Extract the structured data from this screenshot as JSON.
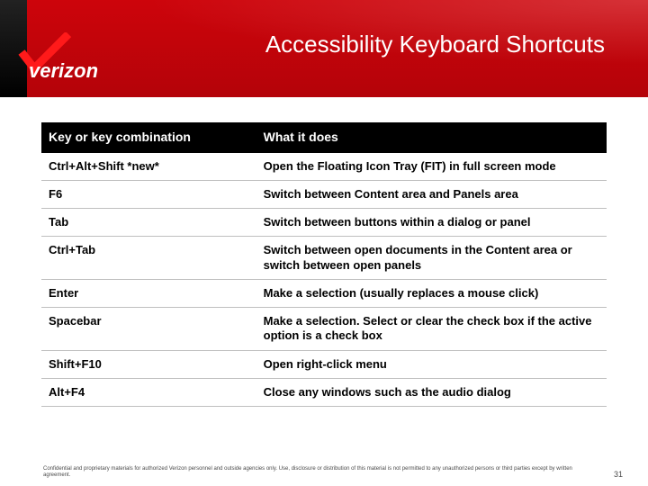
{
  "brand": {
    "name": "verizon"
  },
  "header": {
    "title": "Accessibility Keyboard Shortcuts"
  },
  "table": {
    "header": {
      "key": "Key or key combination",
      "desc": "What it does"
    },
    "rows": [
      {
        "key": "Ctrl+Alt+Shift *new*",
        "desc": "Open the Floating Icon Tray (FIT) in full screen mode"
      },
      {
        "key": "F6",
        "desc": "Switch between Content area and Panels area"
      },
      {
        "key": "Tab",
        "desc": "Switch between buttons within a dialog or panel"
      },
      {
        "key": "Ctrl+Tab",
        "desc": "Switch between open documents in the Content area or switch between open panels"
      },
      {
        "key": "Enter",
        "desc": "Make a selection (usually replaces a mouse click)"
      },
      {
        "key": "Spacebar",
        "desc": "Make a selection. Select or clear the check box if the active option is a check box"
      },
      {
        "key": "Shift+F10",
        "desc": "Open right-click menu"
      },
      {
        "key": "Alt+F4",
        "desc": "Close any windows such as the audio dialog"
      }
    ]
  },
  "footer": {
    "confidential": "Confidential and proprietary materials for authorized Verizon personnel and outside agencies only. Use, disclosure or distribution of this material is not permitted to any unauthorized persons or third parties except by written agreement.",
    "page": "31"
  }
}
